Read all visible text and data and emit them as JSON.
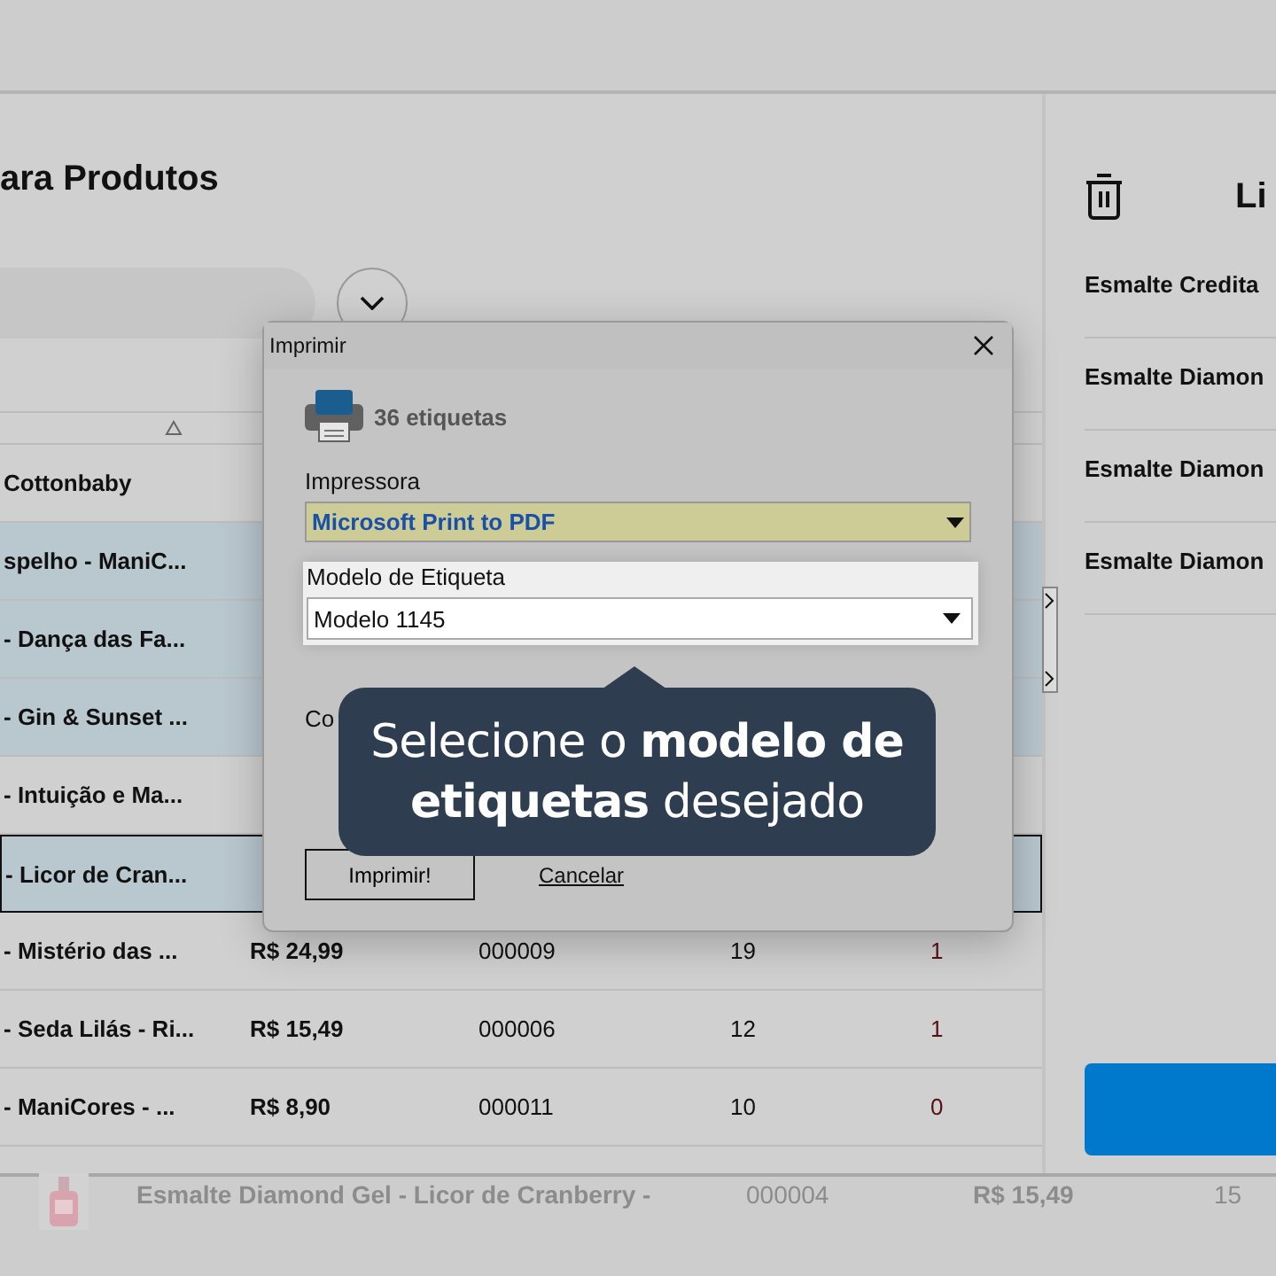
{
  "panel": {
    "title": "ara Produtos"
  },
  "table": {
    "rows": [
      {
        "name": "Cottonbaby",
        "selected": false,
        "focused": false
      },
      {
        "name": "spelho - ManiC...",
        "selected": true,
        "focused": false
      },
      {
        "name": "- Dança das Fa...",
        "selected": true,
        "focused": false
      },
      {
        "name": "- Gin & Sunset ...",
        "selected": true,
        "focused": false
      },
      {
        "name": "- Intuição e Ma...",
        "selected": false,
        "focused": false
      },
      {
        "name": "- Licor de Cran...",
        "selected": true,
        "focused": true
      },
      {
        "name": "- Mistério das ...",
        "price": "R$ 24,99",
        "code": "000009",
        "stock": "19",
        "column_5": "1",
        "selected": false,
        "focused": false
      },
      {
        "name": "- Seda Lilás - Ri...",
        "price": "R$ 15,49",
        "code": "000006",
        "stock": "12",
        "column_5": "1",
        "selected": false,
        "focused": false
      },
      {
        "name": "- ManiCores - ...",
        "price": "R$ 8,90",
        "code": "000011",
        "stock": "10",
        "column_5": "0",
        "selected": false,
        "focused": false
      }
    ]
  },
  "drag_row": {
    "name": "Esmalte Diamond Gel - Licor de Cranberry -",
    "code": "000004",
    "price": "R$ 15,49",
    "stock": "15"
  },
  "list_panel": {
    "title": "Li",
    "items": [
      "Esmalte Credita",
      "Esmalte Diamon",
      "Esmalte Diamon",
      "Esmalte Diamon"
    ]
  },
  "dialog": {
    "title": "Imprimir",
    "count": "36 etiquetas",
    "printer_label": "Impressora",
    "printer": "Microsoft Print to PDF",
    "model_label": "Modelo de Etiqueta",
    "model": "Modelo 1145",
    "fragment": "Co",
    "print_button": "Imprimir!",
    "cancel_link": "Cancelar"
  },
  "tooltip": {
    "text": "Selecione o **modelo de etiquetas** desejado"
  }
}
